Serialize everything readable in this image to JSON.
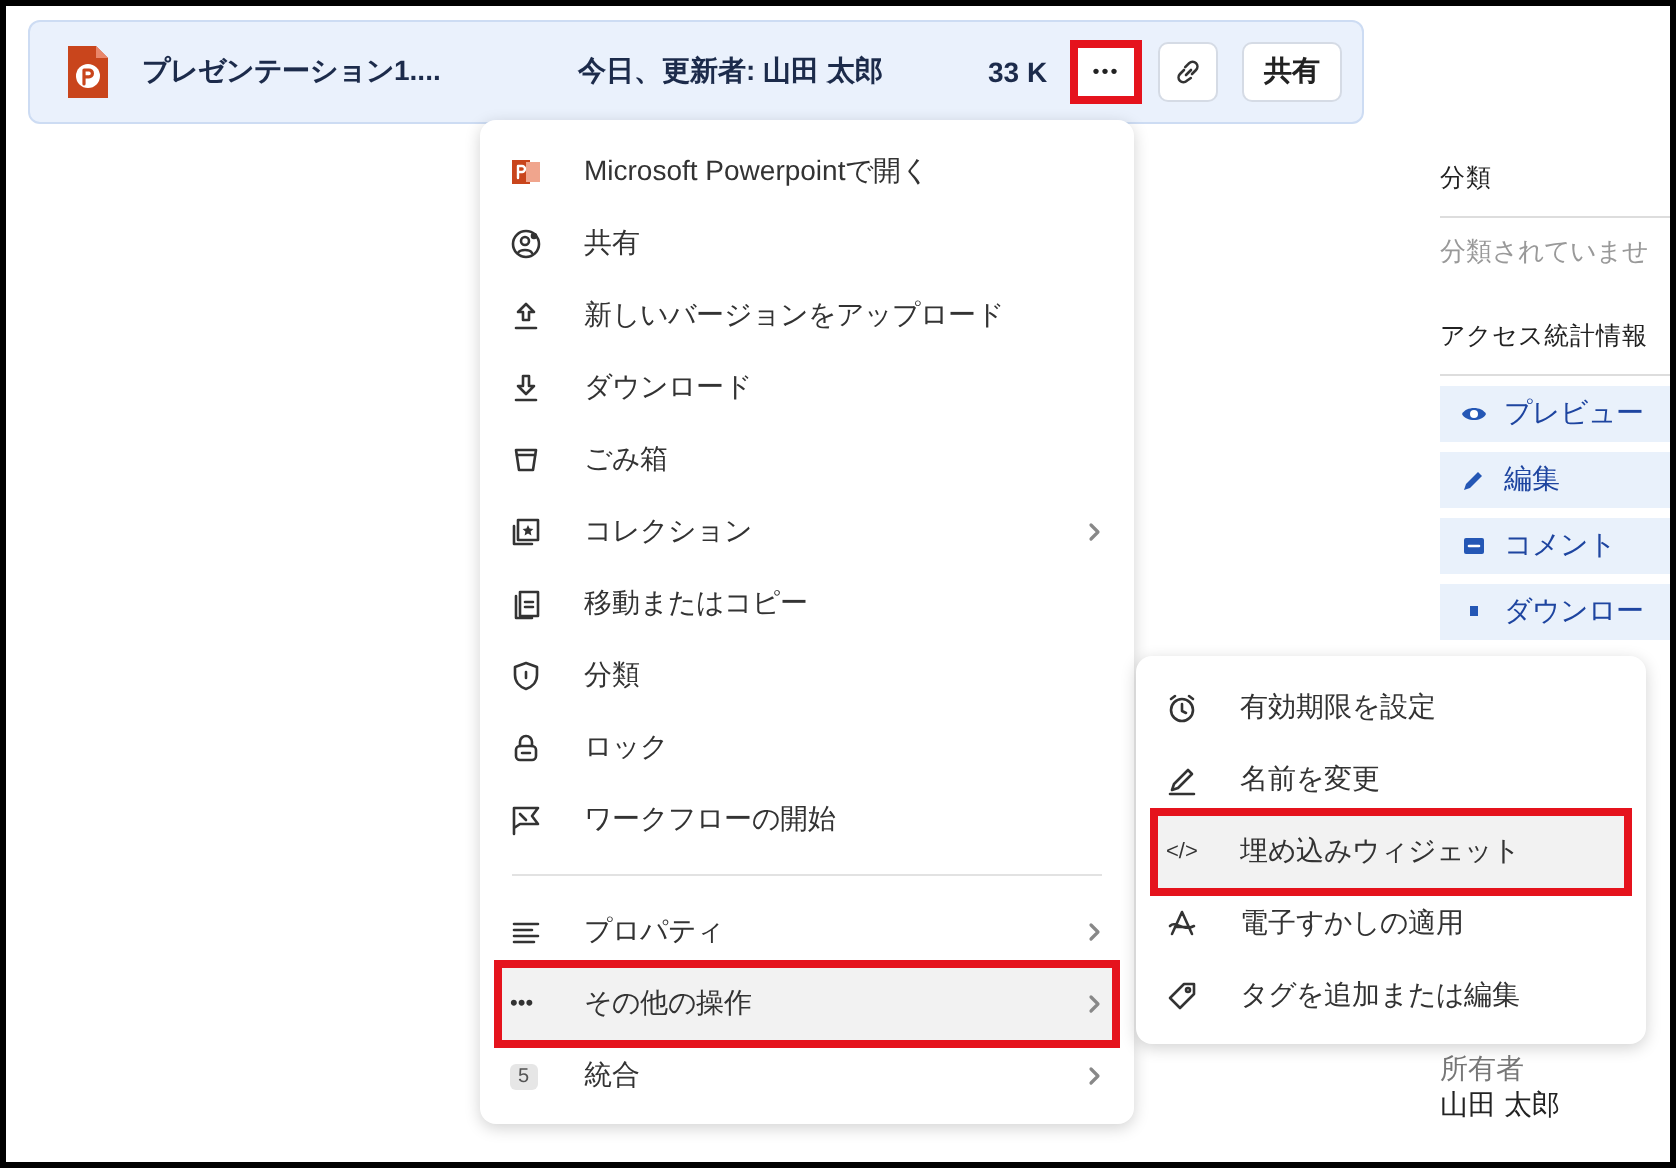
{
  "file_row": {
    "name": "プレゼンテーション1....",
    "modified": "今日、更新者: 山田 太郎",
    "size": "33 K",
    "more_button": {
      "label": "•••",
      "highlighted": true
    },
    "share_button": "共有"
  },
  "details_panel": {
    "classification_heading": "分類",
    "classification_value": "分類されていませ",
    "stats_heading": "アクセス統計情報",
    "stats": [
      {
        "label": "プレビュー"
      },
      {
        "label": "編集"
      },
      {
        "label": "コメント"
      },
      {
        "label": "ダウンロー"
      }
    ],
    "owner_label": "所有者",
    "owner": "山田 太郎"
  },
  "menu": {
    "groups": [
      [
        {
          "label": "Microsoft Powerpointで開く",
          "has_submenu": false,
          "highlighted": false
        },
        {
          "label": "共有",
          "has_submenu": false,
          "highlighted": false
        },
        {
          "label": "新しいバージョンをアップロード",
          "has_submenu": false,
          "highlighted": false
        },
        {
          "label": "ダウンロード",
          "has_submenu": false,
          "highlighted": false
        },
        {
          "label": "ごみ箱",
          "has_submenu": false,
          "highlighted": false
        },
        {
          "label": "コレクション",
          "has_submenu": true,
          "highlighted": false
        },
        {
          "label": "移動またはコピー",
          "has_submenu": false,
          "highlighted": false
        },
        {
          "label": "分類",
          "has_submenu": false,
          "highlighted": false
        },
        {
          "label": "ロック",
          "has_submenu": false,
          "highlighted": false
        },
        {
          "label": "ワークフローの開始",
          "has_submenu": false,
          "highlighted": false
        }
      ],
      [
        {
          "label": "プロパティ",
          "has_submenu": true,
          "highlighted": false
        },
        {
          "label": "その他の操作",
          "has_submenu": true,
          "highlighted": true,
          "icon_text": "•••"
        },
        {
          "label": "統合",
          "has_submenu": true,
          "highlighted": false,
          "badge": "5"
        }
      ]
    ]
  },
  "submenu": {
    "items": [
      {
        "label": "有効期限を設定",
        "highlighted": false
      },
      {
        "label": "名前を変更",
        "highlighted": false
      },
      {
        "label": "埋め込みウィジェット",
        "highlighted": true,
        "icon_text": "</>"
      },
      {
        "label": "電子すかしの適用",
        "highlighted": false
      },
      {
        "label": "タグを追加または編集",
        "highlighted": false
      }
    ]
  }
}
